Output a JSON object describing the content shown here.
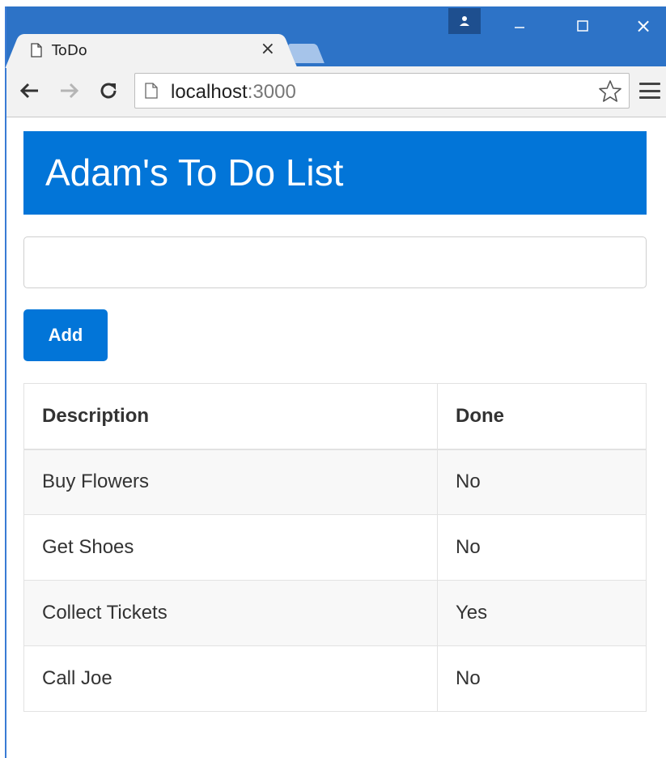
{
  "browser": {
    "tab_title": "ToDo",
    "tab_close": "×",
    "window_close": "×",
    "url_host": "localhost",
    "url_port": ":3000",
    "icons": {
      "tab": "page-icon",
      "omnibox": "page-icon",
      "back": "arrow-left-icon",
      "forward": "arrow-right-icon",
      "reload": "reload-icon",
      "bookmark": "star-icon",
      "menu": "hamburger-icon",
      "profile": "person-icon",
      "minimize": "minimize-icon",
      "maximize": "maximize-icon",
      "close": "close-icon"
    },
    "colors": {
      "titlebar": "#2d73c7",
      "toolbar": "#f2f2f2"
    }
  },
  "app": {
    "title": "Adam's To Do List",
    "input": {
      "value": "",
      "placeholder": ""
    },
    "add_label": "Add",
    "table": {
      "headers": [
        "Description",
        "Done"
      ],
      "rows": [
        {
          "description": "Buy Flowers",
          "done": "No"
        },
        {
          "description": "Get Shoes",
          "done": "No"
        },
        {
          "description": "Collect Tickets",
          "done": "Yes"
        },
        {
          "description": "Call Joe",
          "done": "No"
        }
      ]
    },
    "colors": {
      "primary": "#0275d8",
      "stripe": "#f8f8f8",
      "border": "#e2e2e2"
    }
  }
}
